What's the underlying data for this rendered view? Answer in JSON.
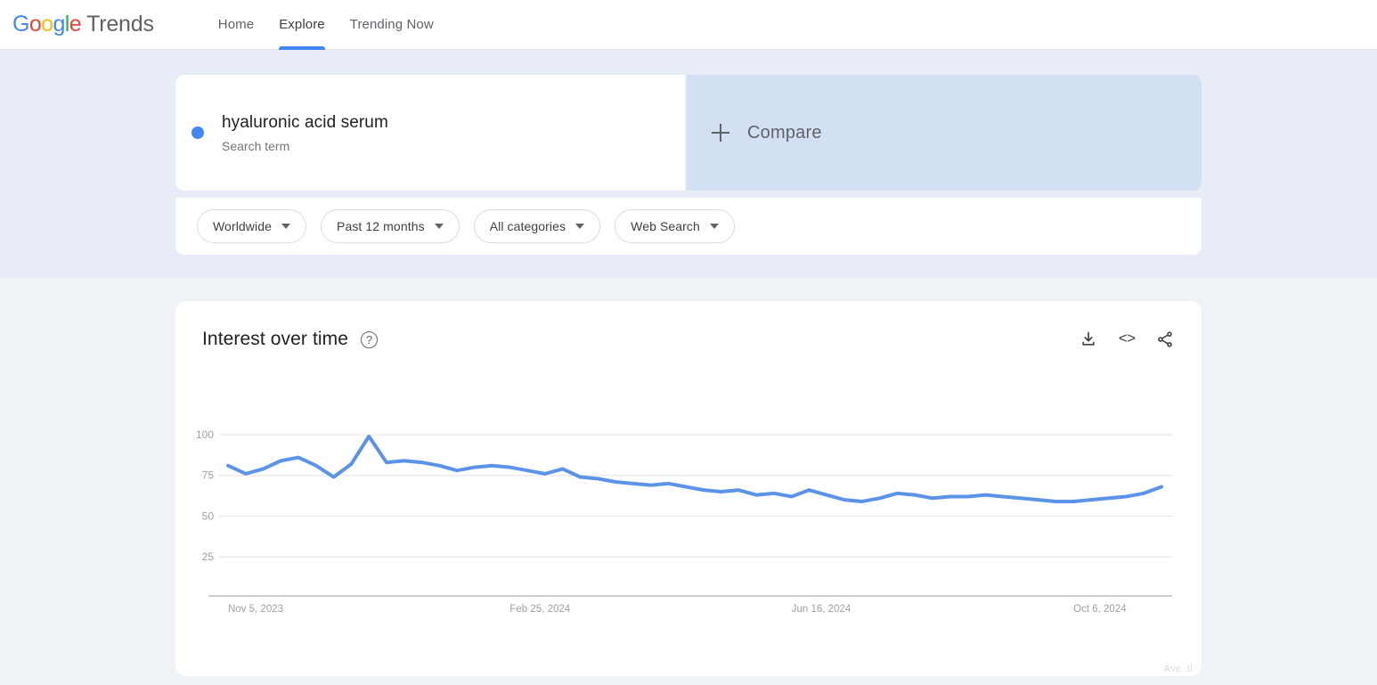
{
  "header": {
    "brand_logo_letters": [
      "G",
      "o",
      "o",
      "g",
      "l",
      "e"
    ],
    "brand_product": "Trends",
    "nav": [
      {
        "label": "Home",
        "active": false
      },
      {
        "label": "Explore",
        "active": true
      },
      {
        "label": "Trending Now",
        "active": false
      }
    ]
  },
  "query": {
    "term": "hyaluronic acid serum",
    "term_type": "Search term",
    "term_color": "#4285f4",
    "compare_label": "Compare",
    "compare_bg": "#d3dff2"
  },
  "filters": [
    {
      "label": "Worldwide"
    },
    {
      "label": "Past 12 months"
    },
    {
      "label": "All categories"
    },
    {
      "label": "Web Search"
    }
  ],
  "chart_card": {
    "title": "Interest over time",
    "help_glyph": "?",
    "actions": [
      {
        "name": "download",
        "label": "⬇"
      },
      {
        "name": "embed",
        "label": "<>"
      },
      {
        "name": "share",
        "label": "share"
      }
    ]
  },
  "watermark": "Ave..ti",
  "chart_data": {
    "type": "line",
    "title": "Interest over time",
    "xlabel": "",
    "ylabel": "",
    "ylim": [
      0,
      105
    ],
    "yticks": [
      25,
      50,
      75,
      100
    ],
    "grid": true,
    "legend": false,
    "line_color": "#5b93e8",
    "line_width": 4,
    "x_tick_labels": [
      "Nov 5, 2023",
      "Feb 25, 2024",
      "Jun 16, 2024",
      "Oct 6, 2024"
    ],
    "x_tick_indices": [
      0,
      16,
      32,
      48
    ],
    "series": [
      {
        "name": "hyaluronic acid serum",
        "color": "#5b93e8",
        "values": [
          81,
          76,
          79,
          84,
          86,
          81,
          74,
          82,
          99,
          83,
          84,
          83,
          81,
          78,
          80,
          81,
          80,
          78,
          76,
          79,
          74,
          73,
          71,
          70,
          69,
          70,
          68,
          66,
          65,
          66,
          63,
          64,
          62,
          66,
          63,
          60,
          59,
          61,
          64,
          63,
          61,
          62,
          62,
          63,
          62,
          61,
          60,
          59,
          59,
          60,
          61,
          62,
          64,
          68
        ]
      }
    ]
  }
}
